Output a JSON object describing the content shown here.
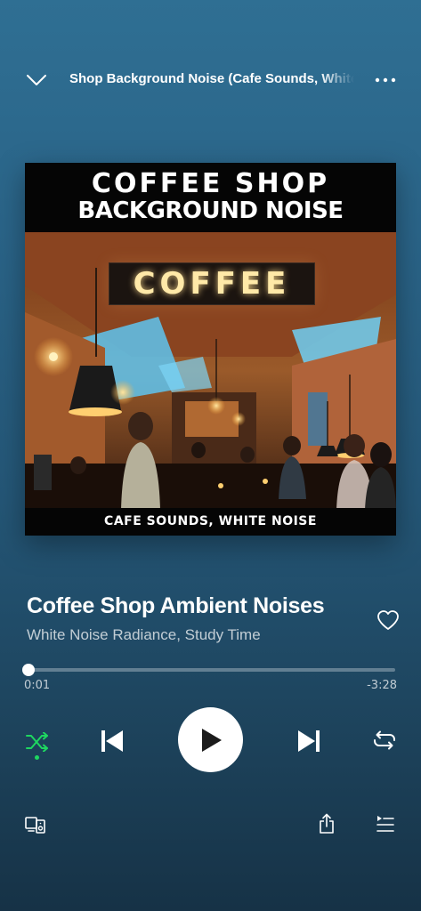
{
  "header": {
    "context_title": "Shop Background Noise (Cafe Sounds, White Noise)",
    "collapse_icon": "chevron-down-icon",
    "more_icon": "more-horizontal-icon"
  },
  "album_art": {
    "banner_line1": "COFFEE SHOP",
    "banner_line2": "BACKGROUND NOISE",
    "sign_text": "COFFEE",
    "footer_text": "CAFE SOUNDS, WHITE NOISE"
  },
  "track": {
    "title": "Coffee Shop Ambient Noises",
    "artists": "White Noise Radiance, Study Time",
    "liked": false
  },
  "playback": {
    "elapsed": "0:01",
    "remaining": "-3:28",
    "progress_fraction": 0.005,
    "shuffle_on": true,
    "repeat_on": false,
    "is_playing": false
  },
  "colors": {
    "accent_green": "#1ed760",
    "background_top": "#2f6f93",
    "background_bottom": "#163246"
  },
  "icons": {
    "shuffle": "shuffle-icon",
    "previous": "skip-previous-icon",
    "play": "play-icon",
    "next": "skip-next-icon",
    "repeat": "repeat-icon",
    "like": "heart-icon",
    "devices": "devices-icon",
    "share": "share-icon",
    "queue": "queue-icon"
  }
}
